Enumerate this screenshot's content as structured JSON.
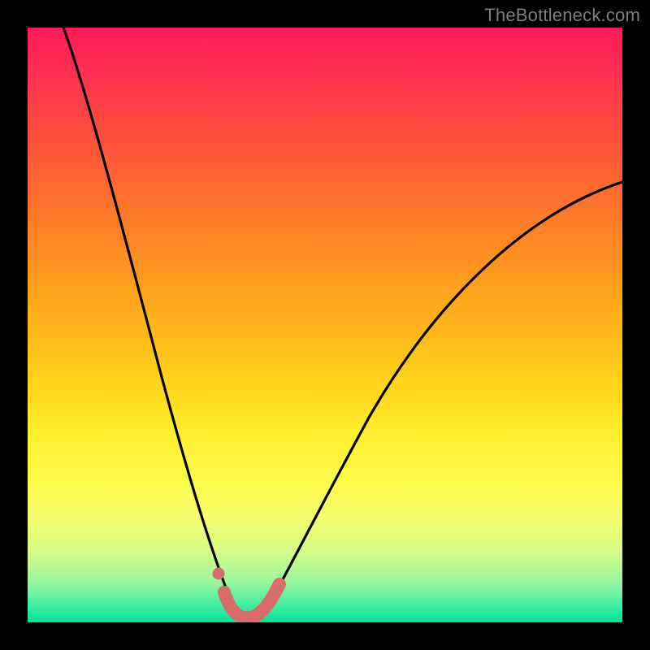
{
  "watermark": {
    "text": "TheBottleneck.com"
  },
  "colors": {
    "background": "#000000",
    "curve": "#000000",
    "marker": "#d86b6b",
    "gradient_top": "#ff1a59",
    "gradient_bottom": "#00e19a"
  },
  "chart_data": {
    "type": "line",
    "title": "",
    "xlabel": "",
    "ylabel": "",
    "xlim": [
      0,
      100
    ],
    "ylim": [
      0,
      100
    ],
    "grid": false,
    "legend": false,
    "series": [
      {
        "name": "bottleneck-curve",
        "x": [
          6,
          8,
          10,
          12,
          14,
          16,
          18,
          20,
          22,
          24,
          26,
          28,
          30,
          32,
          33,
          34,
          35,
          36,
          37,
          38,
          39,
          40,
          42,
          44,
          48,
          52,
          56,
          60,
          64,
          68,
          72,
          76,
          80,
          84,
          88,
          92,
          96,
          100
        ],
        "y": [
          100,
          92,
          84,
          77,
          70,
          63,
          56,
          50,
          44,
          38,
          32,
          26,
          20,
          13,
          10,
          6,
          3,
          1.5,
          1,
          1,
          1.5,
          2.5,
          5,
          9,
          16,
          23,
          29,
          35,
          40,
          45,
          50,
          54,
          58,
          62,
          65,
          68,
          71,
          74
        ]
      },
      {
        "name": "valley-markers",
        "x": [
          32.5,
          33.5,
          34.5,
          35.5,
          36.5,
          37.5,
          38.5,
          39.5,
          40.5
        ],
        "y": [
          9,
          5,
          2.5,
          1.5,
          1,
          1,
          1.5,
          2.5,
          4
        ]
      }
    ],
    "annotations": [
      {
        "text": "TheBottleneck.com",
        "position": "top-right"
      }
    ]
  }
}
